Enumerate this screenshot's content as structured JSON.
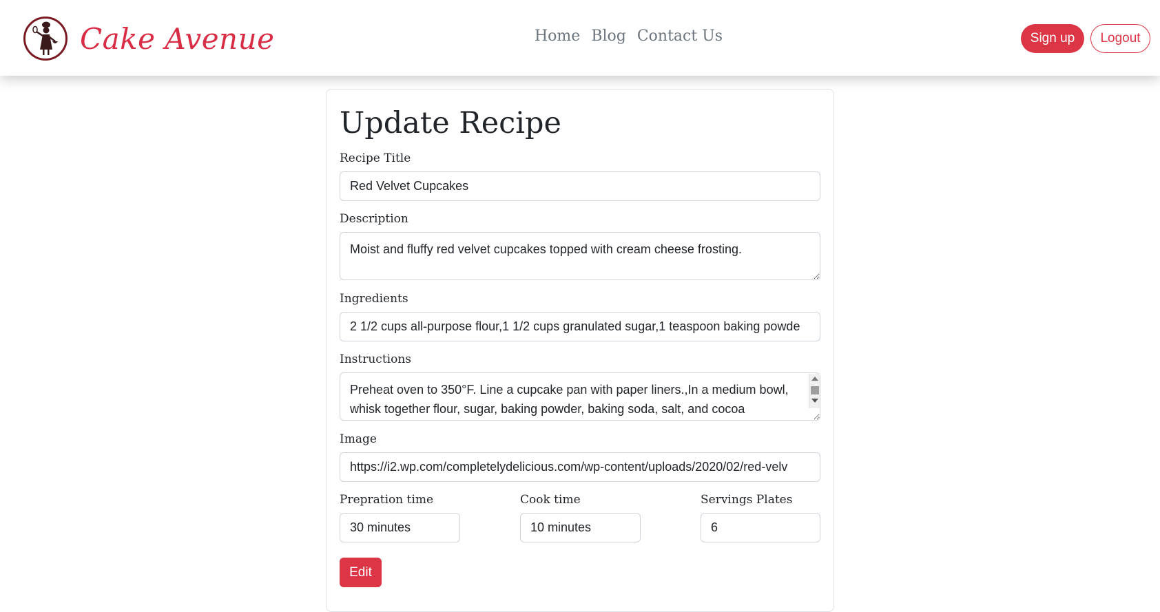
{
  "brand": {
    "name": "Cake Avenue",
    "logo_icon": "chef-silhouette-icon"
  },
  "nav": {
    "links": [
      "Home",
      "Blog",
      "Contact Us"
    ]
  },
  "auth": {
    "signup_label": "Sign up",
    "logout_label": "Logout"
  },
  "form": {
    "heading": "Update Recipe",
    "title_label": "Recipe Title",
    "title_value": "Red Velvet Cupcakes",
    "description_label": "Description",
    "description_value": "Moist and fluffy red velvet cupcakes topped with cream cheese frosting.",
    "ingredients_label": "Ingredients",
    "ingredients_value": "2 1/2 cups all-purpose flour,1 1/2 cups granulated sugar,1 teaspoon baking powde",
    "instructions_label": "Instructions",
    "instructions_value": "Preheat oven to 350°F. Line a cupcake pan with paper liners.,In a medium bowl, whisk together flour, sugar, baking powder, baking soda, salt, and cocoa",
    "image_label": "Image",
    "image_value": "https://i2.wp.com/completelydelicious.com/wp-content/uploads/2020/02/red-velv",
    "prep_label": "Prepration time",
    "prep_value": "30 minutes",
    "cook_label": "Cook time",
    "cook_value": "10 minutes",
    "servings_label": "Servings Plates",
    "servings_value": "6",
    "submit_label": "Edit"
  },
  "colors": {
    "accent": "#dc3545",
    "brand": "#d92d45",
    "nav_link": "#6c757d"
  }
}
